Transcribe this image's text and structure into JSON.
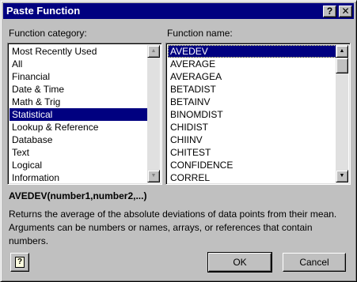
{
  "window": {
    "title": "Paste Function",
    "help_glyph": "?",
    "close_glyph": "✕"
  },
  "category": {
    "label": "Function category:",
    "items": [
      "Most Recently Used",
      "All",
      "Financial",
      "Date & Time",
      "Math & Trig",
      "Statistical",
      "Lookup & Reference",
      "Database",
      "Text",
      "Logical",
      "Information"
    ],
    "selected": "Statistical"
  },
  "function": {
    "label": "Function name:",
    "items": [
      "AVEDEV",
      "AVERAGE",
      "AVERAGEA",
      "BETADIST",
      "BETAINV",
      "BINOMDIST",
      "CHIDIST",
      "CHIINV",
      "CHITEST",
      "CONFIDENCE",
      "CORREL"
    ],
    "selected": "AVEDEV"
  },
  "syntax": "AVEDEV(number1,number2,...)",
  "description": "Returns the average of the absolute deviations of data points from their mean. Arguments can be numbers or names, arrays, or references that contain numbers.",
  "buttons": {
    "ok": "OK",
    "cancel": "Cancel",
    "office_assistant_glyph": "?"
  },
  "icons": {
    "help": "help-icon",
    "close": "close-icon",
    "scroll_up": "arrow-up-icon",
    "scroll_down": "arrow-down-icon",
    "office_assistant": "office-assistant-icon"
  }
}
